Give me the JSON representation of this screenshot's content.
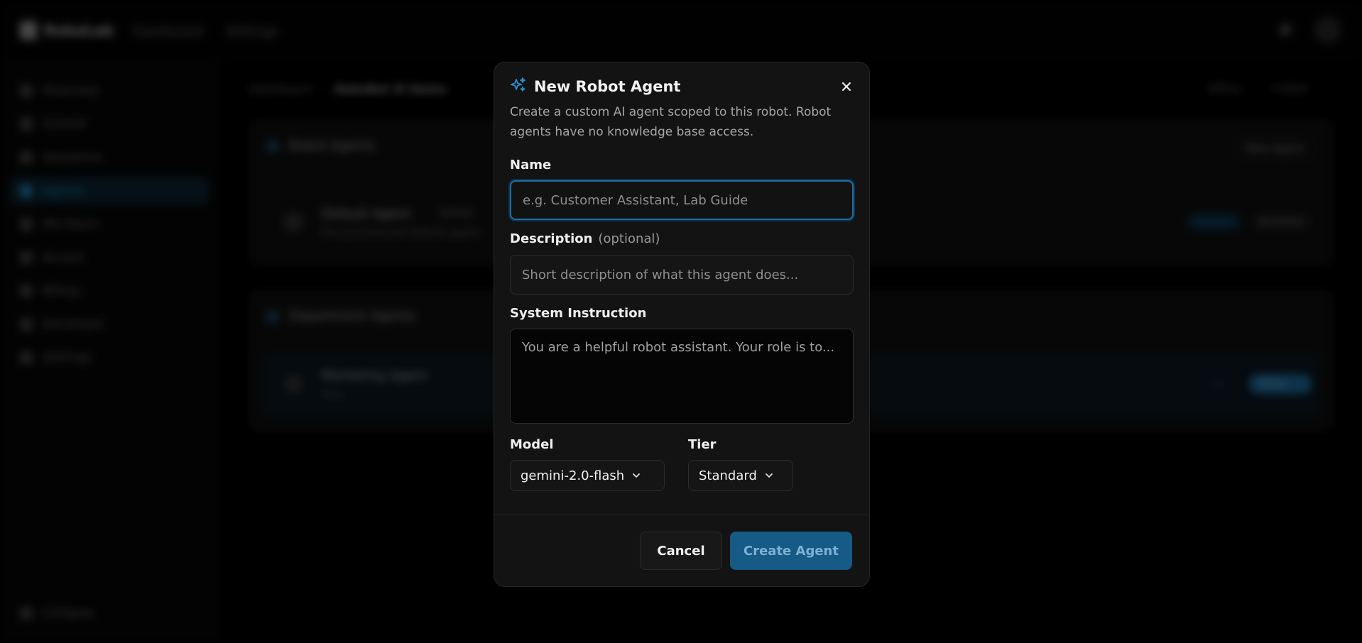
{
  "app": {
    "brand": "RoboLab",
    "nav": [
      "Dashboard",
      "Settings"
    ]
  },
  "sidebar": {
    "items": [
      "Overview",
      "Control",
      "Sequence",
      "Agents",
      "Members",
      "Access",
      "Billing",
      "Developer",
      "Settings"
    ],
    "active": "Agents",
    "collapse": "Collapse"
  },
  "breadcrumb": {
    "root": "Dashboard",
    "current": "RoboBot XI Demo"
  },
  "header_meta": {
    "status": "Offline",
    "id": "X-9000"
  },
  "robot_agents": {
    "title": "Robot Agents",
    "new_button": "New Agent",
    "rows": [
      {
        "name": "Default Agent",
        "badge": "Default",
        "subtitle": "Pre-provisioned default agent",
        "status": "Standard",
        "action": "Set Active"
      }
    ]
  },
  "department_agents": {
    "title": "Department Agents",
    "rows": [
      {
        "name": "Marketing Agent",
        "subtitle": "Pool",
        "status": "Copy",
        "action": "Active"
      }
    ]
  },
  "modal": {
    "title": "New Robot Agent",
    "description": "Create a custom AI agent scoped to this robot. Robot agents have no knowledge base access.",
    "name_label": "Name",
    "name_placeholder": "e.g. Customer Assistant, Lab Guide",
    "description_label": "Description",
    "description_optional": "(optional)",
    "description_placeholder": "Short description of what this agent does...",
    "instruction_label": "System Instruction",
    "instruction_placeholder": "You are a helpful robot assistant. Your role is to...",
    "model_label": "Model",
    "model_value": "gemini-2.0-flash",
    "tier_label": "Tier",
    "tier_value": "Standard",
    "cancel_label": "Cancel",
    "create_label": "Create Agent"
  },
  "colors": {
    "accent": "#165a86",
    "focus_ring": "#1d6fa3",
    "sparkle_icon": "#2a8fd0"
  },
  "icons": {
    "title": "sparkles-icon",
    "close": "close-icon",
    "dropdown": "chevron-down-icon"
  }
}
